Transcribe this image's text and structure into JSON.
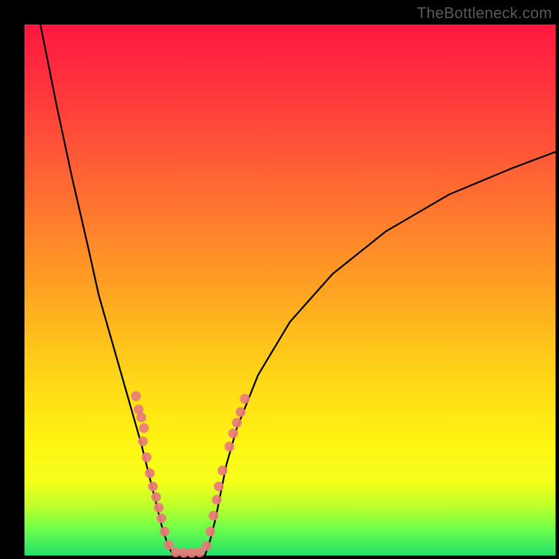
{
  "watermark": "TheBottleneck.com",
  "colors": {
    "frame": "#000000",
    "curve": "#000000",
    "dot_fill": "#e97b7b",
    "dot_stroke": "#c24a4a"
  },
  "chart_data": {
    "type": "line",
    "title": "",
    "xlabel": "",
    "ylabel": "",
    "xlim": [
      0,
      100
    ],
    "ylim": [
      0,
      100
    ],
    "note": "Axes are not labeled in the image; x/y are normalized 0–100. y=0 is the bottom (green) edge.",
    "series": [
      {
        "name": "left-branch",
        "x": [
          3,
          6,
          9,
          12,
          14,
          16,
          18,
          20,
          22,
          24,
          25,
          26,
          27,
          28
        ],
        "y": [
          100,
          85,
          71,
          58,
          49,
          42,
          35,
          28,
          21,
          13,
          9,
          5,
          2,
          0
        ]
      },
      {
        "name": "valley-floor",
        "x": [
          28,
          30,
          32,
          34
        ],
        "y": [
          0,
          0,
          0,
          0
        ]
      },
      {
        "name": "right-branch",
        "x": [
          34,
          35,
          36,
          37,
          38,
          40,
          44,
          50,
          58,
          68,
          80,
          92,
          100
        ],
        "y": [
          0,
          3,
          7,
          12,
          17,
          24,
          34,
          44,
          53,
          61,
          68,
          73,
          76
        ]
      }
    ],
    "dots": {
      "note": "Salmon bead markers scattered along the lower V; normalized coords.",
      "points": [
        {
          "x": 21.0,
          "y": 30.0
        },
        {
          "x": 21.5,
          "y": 27.5
        },
        {
          "x": 22.0,
          "y": 26.0
        },
        {
          "x": 22.5,
          "y": 24.0
        },
        {
          "x": 22.3,
          "y": 21.5
        },
        {
          "x": 23.0,
          "y": 18.5
        },
        {
          "x": 23.6,
          "y": 15.5
        },
        {
          "x": 24.2,
          "y": 13.0
        },
        {
          "x": 24.8,
          "y": 11.0
        },
        {
          "x": 25.3,
          "y": 9.0
        },
        {
          "x": 25.8,
          "y": 7.0
        },
        {
          "x": 26.4,
          "y": 4.5
        },
        {
          "x": 27.2,
          "y": 2.0
        },
        {
          "x": 28.5,
          "y": 0.6
        },
        {
          "x": 30.0,
          "y": 0.5
        },
        {
          "x": 31.5,
          "y": 0.5
        },
        {
          "x": 33.0,
          "y": 0.6
        },
        {
          "x": 34.3,
          "y": 1.8
        },
        {
          "x": 35.0,
          "y": 4.5
        },
        {
          "x": 35.6,
          "y": 7.5
        },
        {
          "x": 36.2,
          "y": 10.5
        },
        {
          "x": 36.6,
          "y": 13.0
        },
        {
          "x": 37.3,
          "y": 16.0
        },
        {
          "x": 38.6,
          "y": 20.5
        },
        {
          "x": 39.3,
          "y": 23.0
        },
        {
          "x": 40.0,
          "y": 25.0
        },
        {
          "x": 40.7,
          "y": 27.0
        },
        {
          "x": 41.5,
          "y": 29.5
        }
      ]
    }
  }
}
